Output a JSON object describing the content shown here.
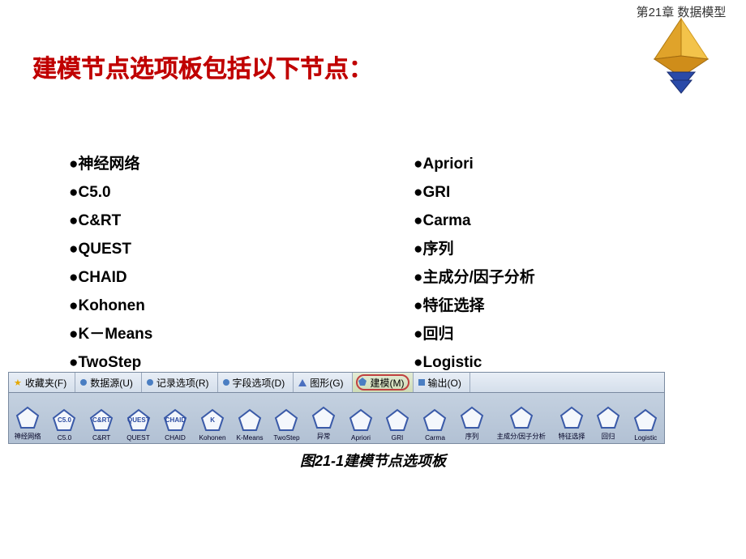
{
  "header": {
    "chapter": "第21章 数据模型"
  },
  "title": "建模节点选项板包括以下节点：",
  "list_left": [
    "神经网络",
    "C5.0",
    "C&RT",
    "QUEST",
    "CHAID",
    "Kohonen",
    "K－Means",
    "TwoStep"
  ],
  "list_right": [
    "Apriori",
    "GRI",
    "Carma",
    "序列",
    "主成分/因子分析",
    "特征选择",
    "回归",
    "Logistic"
  ],
  "tabs": [
    {
      "label": "收藏夹(F)",
      "icon": "star"
    },
    {
      "label": "数据源(U)",
      "icon": "circle"
    },
    {
      "label": "记录选项(R)",
      "icon": "circle"
    },
    {
      "label": "字段选项(D)",
      "icon": "circle"
    },
    {
      "label": "图形(G)",
      "icon": "triangle"
    },
    {
      "label": "建模(M)",
      "icon": "pentagon",
      "active": true
    },
    {
      "label": "输出(O)",
      "icon": "square"
    }
  ],
  "nodes": [
    {
      "label": "神经网络",
      "inner": ""
    },
    {
      "label": "C5.0",
      "inner": "C5.0"
    },
    {
      "label": "C&RT",
      "inner": "C&RT"
    },
    {
      "label": "QUEST",
      "inner": "QUEST"
    },
    {
      "label": "CHAID",
      "inner": "CHAID"
    },
    {
      "label": "Kohonen",
      "inner": "K"
    },
    {
      "label": "K-Means",
      "inner": ""
    },
    {
      "label": "TwoStep",
      "inner": ""
    },
    {
      "label": "异常",
      "inner": ""
    },
    {
      "label": "Apriori",
      "inner": ""
    },
    {
      "label": "GRI",
      "inner": ""
    },
    {
      "label": "Carma",
      "inner": ""
    },
    {
      "label": "序列",
      "inner": ""
    },
    {
      "label": "主成分/因子分析",
      "inner": "",
      "wide": true
    },
    {
      "label": "特征选择",
      "inner": ""
    },
    {
      "label": "回归",
      "inner": ""
    },
    {
      "label": "Logistic",
      "inner": ""
    }
  ],
  "caption": "图21-1建模节点选项板"
}
